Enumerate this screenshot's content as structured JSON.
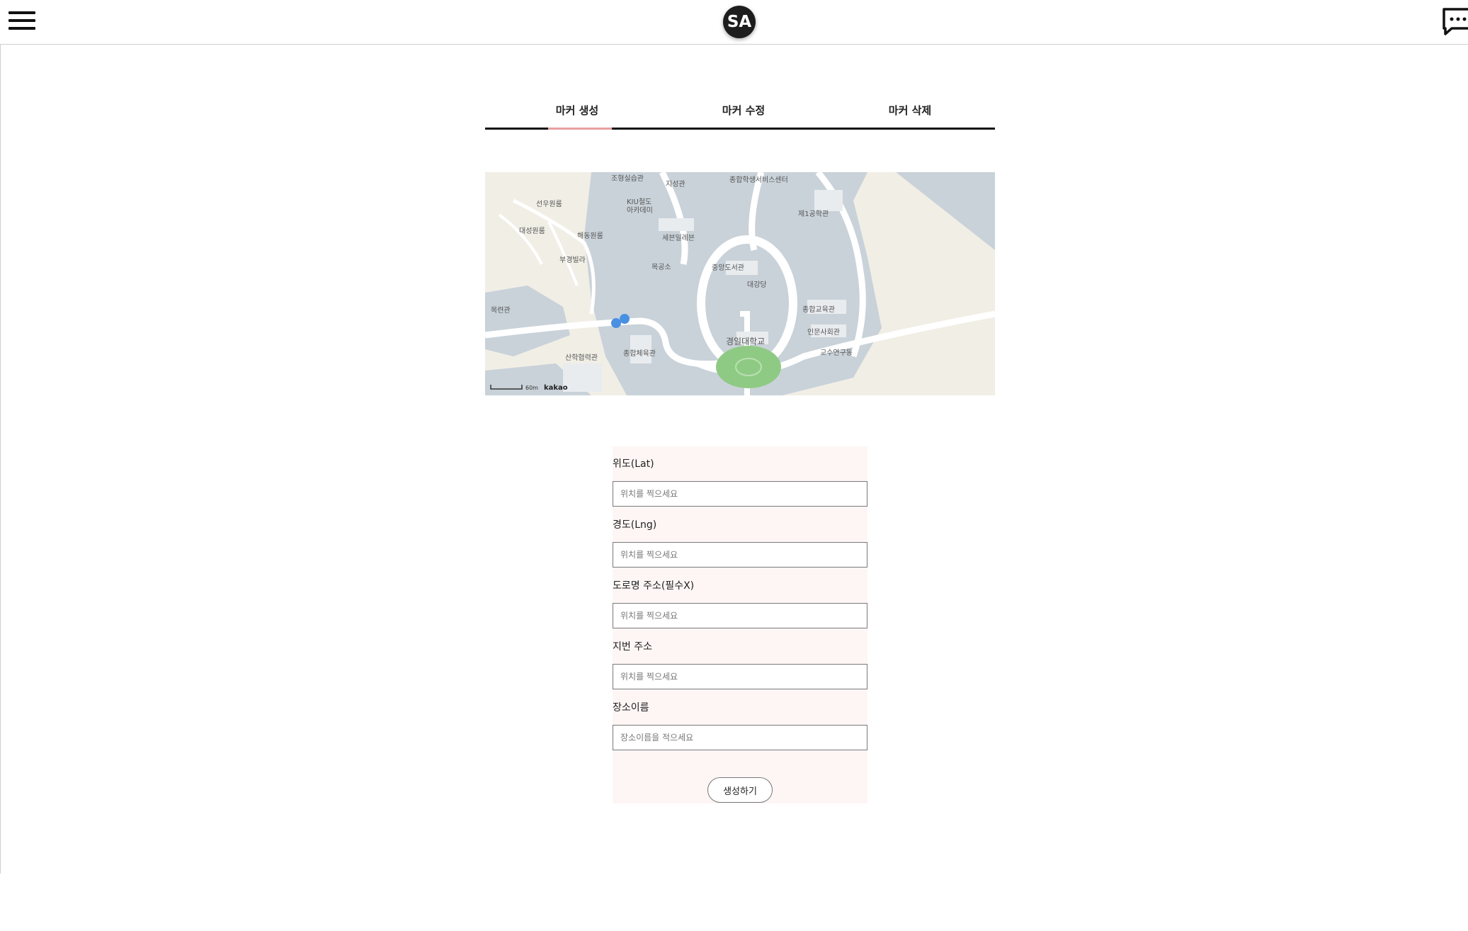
{
  "header": {
    "menu_icon": "hamburger-menu-icon",
    "logo_text": "SA",
    "chat_icon": "chat-bubble-icon"
  },
  "tabs": [
    {
      "label": "마커 생성",
      "active": true
    },
    {
      "label": "마커 수정",
      "active": false
    },
    {
      "label": "마커 삭제",
      "active": false
    }
  ],
  "map": {
    "labels": {
      "l1": "조형실습관",
      "l2": "지성관",
      "l3": "종합학생서비스센터",
      "l4": "선우원룸",
      "l5": "KIU철도",
      "l6": "아카데미",
      "l7": "제1공학관",
      "l8": "대성원룸",
      "l9": "해동원룸",
      "l10": "세븐일레븐",
      "l11": "부경빌라",
      "l12": "목공소",
      "l13": "중앙도서관",
      "l14": "대강당",
      "l15": "목련관",
      "l16": "종합교육관",
      "l17": "인문사회관",
      "l18": "경일대학교",
      "l19": "산학협력관",
      "l20": "종합체육관",
      "l21": "교수연구동"
    },
    "scale": "60m",
    "provider": "kakao"
  },
  "form": {
    "lat_label": "위도(Lat)",
    "lat_placeholder": "위치를 찍으세요",
    "lng_label": "경도(Lng)",
    "lng_placeholder": "위치를 찍으세요",
    "road_label": "도로명 주소(필수X)",
    "road_placeholder": "위치를 찍으세요",
    "jibun_label": "지번 주소",
    "jibun_placeholder": "위치를 찍으세요",
    "name_label": "장소이름",
    "name_placeholder": "장소이름을 적으세요",
    "submit_label": "생성하기"
  },
  "colors": {
    "tab_active_underline": "#e8a0a0",
    "form_bg": "#fdf6f5",
    "logo_bg": "#1d1d1d"
  }
}
